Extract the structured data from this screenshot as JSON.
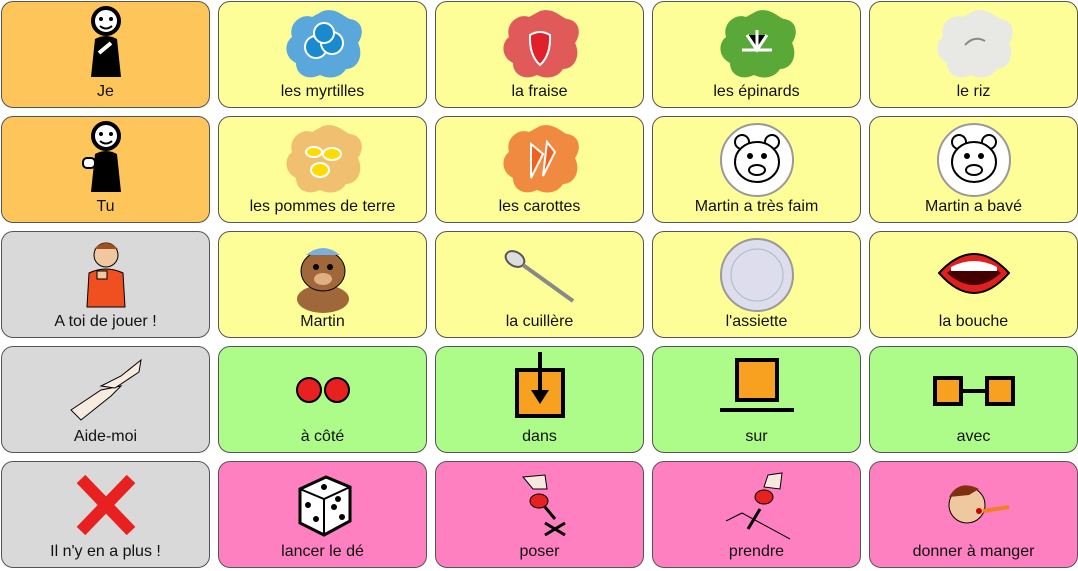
{
  "colors": {
    "pronoun": "#fdc55a",
    "noun": "#fefe98",
    "social": "#d9d9d9",
    "preposition": "#adfc8a",
    "verb": "#fe80c0"
  },
  "cells": [
    {
      "label": "Je",
      "icon": "person-pointing-self-icon",
      "category": "pronoun"
    },
    {
      "label": "les myrtilles",
      "icon": "blueberries-icon",
      "category": "noun"
    },
    {
      "label": "la fraise",
      "icon": "strawberry-icon",
      "category": "noun"
    },
    {
      "label": "les épinards",
      "icon": "spinach-icon",
      "category": "noun"
    },
    {
      "label": "le riz",
      "icon": "rice-icon",
      "category": "noun"
    },
    {
      "label": "Tu",
      "icon": "person-pointing-you-icon",
      "category": "pronoun"
    },
    {
      "label": "les pommes de terre",
      "icon": "potatoes-icon",
      "category": "noun"
    },
    {
      "label": "les carottes",
      "icon": "carrots-icon",
      "category": "noun"
    },
    {
      "label": "Martin a très faim",
      "icon": "hungry-bear-icon",
      "category": "noun"
    },
    {
      "label": "Martin a bavé",
      "icon": "drooling-bear-icon",
      "category": "noun"
    },
    {
      "label": "A toi de jouer !",
      "icon": "boy-pointing-icon",
      "category": "social"
    },
    {
      "label": "Martin",
      "icon": "bear-icon",
      "category": "noun"
    },
    {
      "label": "la cuillère",
      "icon": "spoon-icon",
      "category": "noun"
    },
    {
      "label": "l'assiette",
      "icon": "plate-icon",
      "category": "noun"
    },
    {
      "label": "la bouche",
      "icon": "mouth-icon",
      "category": "noun"
    },
    {
      "label": "Aide-moi",
      "icon": "helping-hands-icon",
      "category": "social"
    },
    {
      "label": "à côté",
      "icon": "next-to-icon",
      "category": "preposition"
    },
    {
      "label": "dans",
      "icon": "in-icon",
      "category": "preposition"
    },
    {
      "label": "sur",
      "icon": "on-icon",
      "category": "preposition"
    },
    {
      "label": "avec",
      "icon": "with-icon",
      "category": "preposition"
    },
    {
      "label": "Il n'y en a plus !",
      "icon": "red-cross-icon",
      "category": "social"
    },
    {
      "label": "lancer le dé",
      "icon": "dice-icon",
      "category": "verb"
    },
    {
      "label": "poser",
      "icon": "put-down-icon",
      "category": "verb"
    },
    {
      "label": "prendre",
      "icon": "pick-up-icon",
      "category": "verb"
    },
    {
      "label": "donner à manger",
      "icon": "feeding-icon",
      "category": "verb"
    }
  ]
}
